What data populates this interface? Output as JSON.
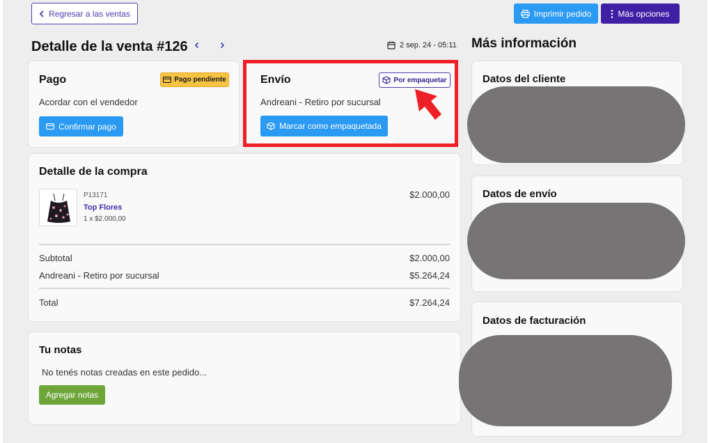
{
  "header": {
    "back_label": "Regresar a las ventas",
    "print_label": "Imprimir pedido",
    "more_label": "Más opciones"
  },
  "order": {
    "title": "Detalle de la venta #126",
    "date": "2 sep. 24 - 05:11"
  },
  "pago": {
    "title": "Pago",
    "badge": "Pago pendiente",
    "text": "Acordar con el vendedor",
    "button": "Confirmar pago"
  },
  "envio": {
    "title": "Envío",
    "badge": "Por empaquetar",
    "text": "Andreani - Retiro por sucursal",
    "button": "Marcar como empaquetada"
  },
  "compra": {
    "title": "Detalle de la compra",
    "product": {
      "sku": "P13171",
      "name": "Top Flores",
      "qty": "1 x $2.000,00",
      "price": "$2.000,00"
    },
    "rows": [
      {
        "label": "Subtotal",
        "value": "$2.000,00"
      },
      {
        "label": "Andreani - Retiro por sucursal",
        "value": "$5.264,24"
      },
      {
        "label": "Total",
        "value": "$7.264,24"
      }
    ]
  },
  "notas": {
    "title": "Tu notas",
    "empty": "No tenés notas creadas en este pedido...",
    "button": "Agregar notas"
  },
  "info": {
    "title": "Más información",
    "cliente": "Datos del cliente",
    "envio": "Datos de envío",
    "facturacion": "Datos de facturación"
  },
  "colors": {
    "primary_blue": "#2b9af3",
    "purple": "#3f1fa3",
    "pending_yellow": "#f6c343",
    "green": "#6ea63a",
    "highlight_red": "#ee1f26"
  },
  "icons": [
    "chevron-left-icon",
    "printer-icon",
    "dots-vertical-icon",
    "chevron-right-icon",
    "calendar-icon",
    "credit-card-icon",
    "package-icon",
    "arrow-pointer-icon"
  ]
}
